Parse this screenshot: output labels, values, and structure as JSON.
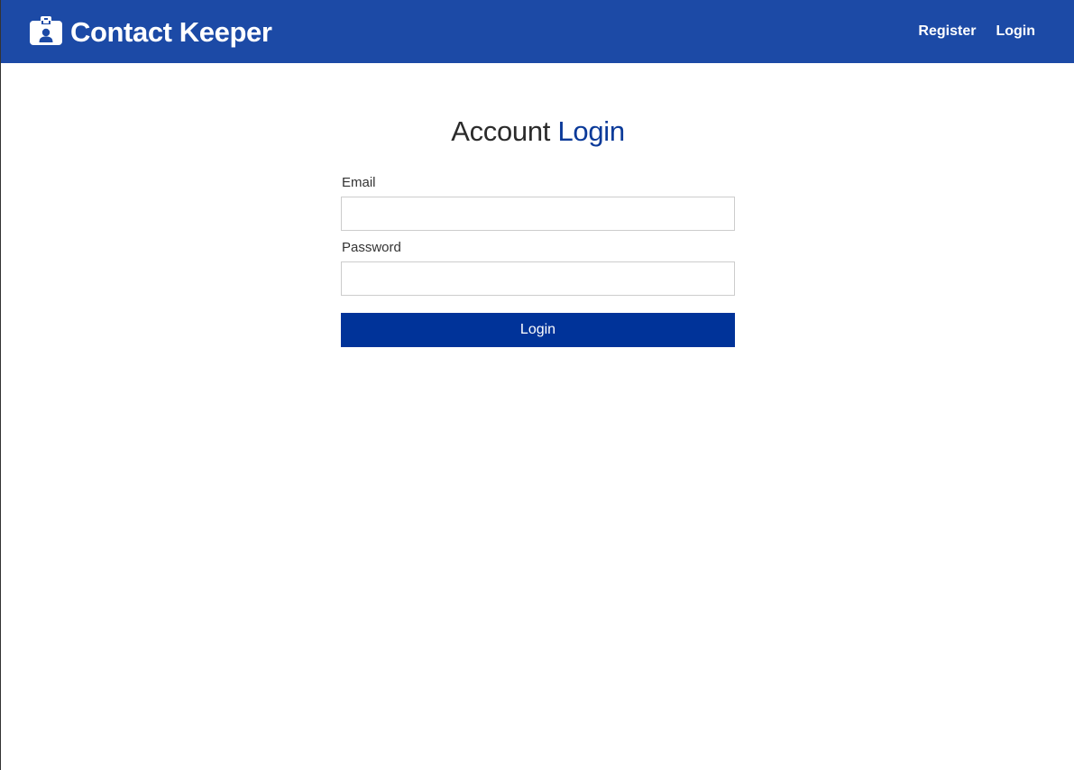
{
  "navbar": {
    "brand_title": "Contact Keeper",
    "brand_icon": "id-badge-icon",
    "links": {
      "register": "Register",
      "login": "Login"
    }
  },
  "page": {
    "title_prefix": "Account",
    "title_accent": "Login"
  },
  "form": {
    "email_label": "Email",
    "email_value": "",
    "email_placeholder": "",
    "password_label": "Password",
    "password_value": "",
    "password_placeholder": "",
    "submit_label": "Login"
  },
  "colors": {
    "navbar_bg": "#1c4aa6",
    "accent": "#0b3a99",
    "button_bg": "#003399",
    "text": "#333333"
  }
}
